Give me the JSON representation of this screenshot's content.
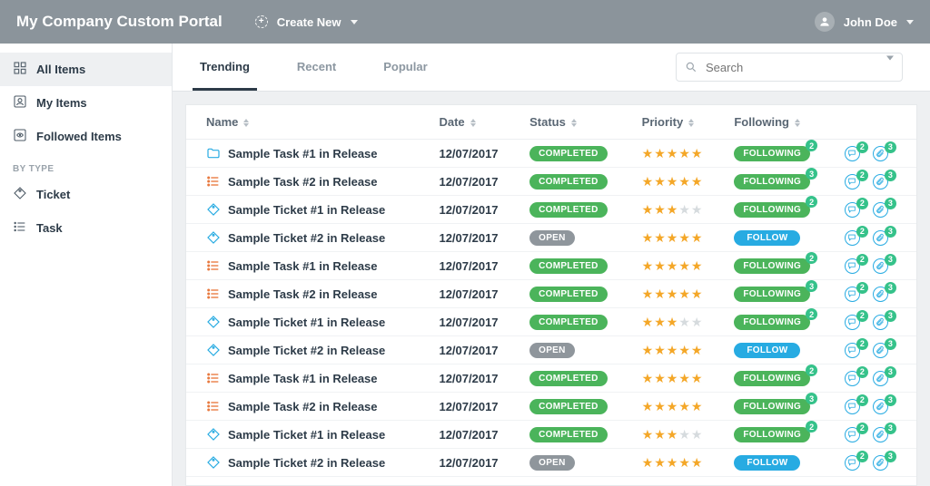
{
  "header": {
    "brand": "My Company Custom Portal",
    "create": "Create New",
    "user": "John Doe"
  },
  "sidebar": {
    "items": [
      {
        "id": "all-items",
        "label": "All Items",
        "active": true,
        "icon": "grid"
      },
      {
        "id": "my-items",
        "label": "My Items",
        "active": false,
        "icon": "person-box"
      },
      {
        "id": "followed-items",
        "label": "Followed Items",
        "active": false,
        "icon": "eye-box"
      }
    ],
    "type_heading": "BY TYPE",
    "types": [
      {
        "id": "ticket",
        "label": "Ticket",
        "icon": "tag"
      },
      {
        "id": "task",
        "label": "Task",
        "icon": "list"
      }
    ]
  },
  "tabs": [
    {
      "id": "trending",
      "label": "Trending",
      "active": true
    },
    {
      "id": "recent",
      "label": "Recent",
      "active": false
    },
    {
      "id": "popular",
      "label": "Popular",
      "active": false
    }
  ],
  "search": {
    "placeholder": "Search"
  },
  "columns": {
    "name": "Name",
    "date": "Date",
    "status": "Status",
    "priority": "Priority",
    "following": "Following"
  },
  "status_labels": {
    "completed": "COMPLETED",
    "open": "OPEN"
  },
  "follow_labels": {
    "following": "FOLLOWING",
    "follow": "FOLLOW"
  },
  "rows": [
    {
      "icon": "folder",
      "name": "Sample Task #1 in Release",
      "date": "12/07/2017",
      "status": "completed",
      "stars": 5,
      "following": true,
      "follow_count": 2,
      "comments": 2,
      "attach": 3
    },
    {
      "icon": "task",
      "name": "Sample Task #2 in Release",
      "date": "12/07/2017",
      "status": "completed",
      "stars": 5,
      "following": true,
      "follow_count": 3,
      "comments": 2,
      "attach": 3
    },
    {
      "icon": "ticket",
      "name": "Sample Ticket #1 in Release",
      "date": "12/07/2017",
      "status": "completed",
      "stars": 3,
      "following": true,
      "follow_count": 2,
      "comments": 2,
      "attach": 3
    },
    {
      "icon": "ticket",
      "name": "Sample Ticket #2 in Release",
      "date": "12/07/2017",
      "status": "open",
      "stars": 5,
      "following": false,
      "follow_count": null,
      "comments": 2,
      "attach": 3
    },
    {
      "icon": "task",
      "name": "Sample Task #1 in Release",
      "date": "12/07/2017",
      "status": "completed",
      "stars": 5,
      "following": true,
      "follow_count": 2,
      "comments": 2,
      "attach": 3
    },
    {
      "icon": "task",
      "name": "Sample Task #2 in Release",
      "date": "12/07/2017",
      "status": "completed",
      "stars": 5,
      "following": true,
      "follow_count": 3,
      "comments": 2,
      "attach": 3
    },
    {
      "icon": "ticket",
      "name": "Sample Ticket #1 in Release",
      "date": "12/07/2017",
      "status": "completed",
      "stars": 3,
      "following": true,
      "follow_count": 2,
      "comments": 2,
      "attach": 3
    },
    {
      "icon": "ticket",
      "name": "Sample Ticket #2 in Release",
      "date": "12/07/2017",
      "status": "open",
      "stars": 5,
      "following": false,
      "follow_count": null,
      "comments": 2,
      "attach": 3
    },
    {
      "icon": "task",
      "name": "Sample Task #1 in Release",
      "date": "12/07/2017",
      "status": "completed",
      "stars": 5,
      "following": true,
      "follow_count": 2,
      "comments": 2,
      "attach": 3
    },
    {
      "icon": "task",
      "name": "Sample Task #2 in Release",
      "date": "12/07/2017",
      "status": "completed",
      "stars": 5,
      "following": true,
      "follow_count": 3,
      "comments": 2,
      "attach": 3
    },
    {
      "icon": "ticket",
      "name": "Sample Ticket #1 in Release",
      "date": "12/07/2017",
      "status": "completed",
      "stars": 3,
      "following": true,
      "follow_count": 2,
      "comments": 2,
      "attach": 3
    },
    {
      "icon": "ticket",
      "name": "Sample Ticket #2 in Release",
      "date": "12/07/2017",
      "status": "open",
      "stars": 5,
      "following": false,
      "follow_count": null,
      "comments": 2,
      "attach": 3
    }
  ],
  "colors": {
    "accent_green": "#4bb45b",
    "accent_blue": "#27abe2",
    "star": "#f4a728",
    "mint": "#35c28a"
  }
}
